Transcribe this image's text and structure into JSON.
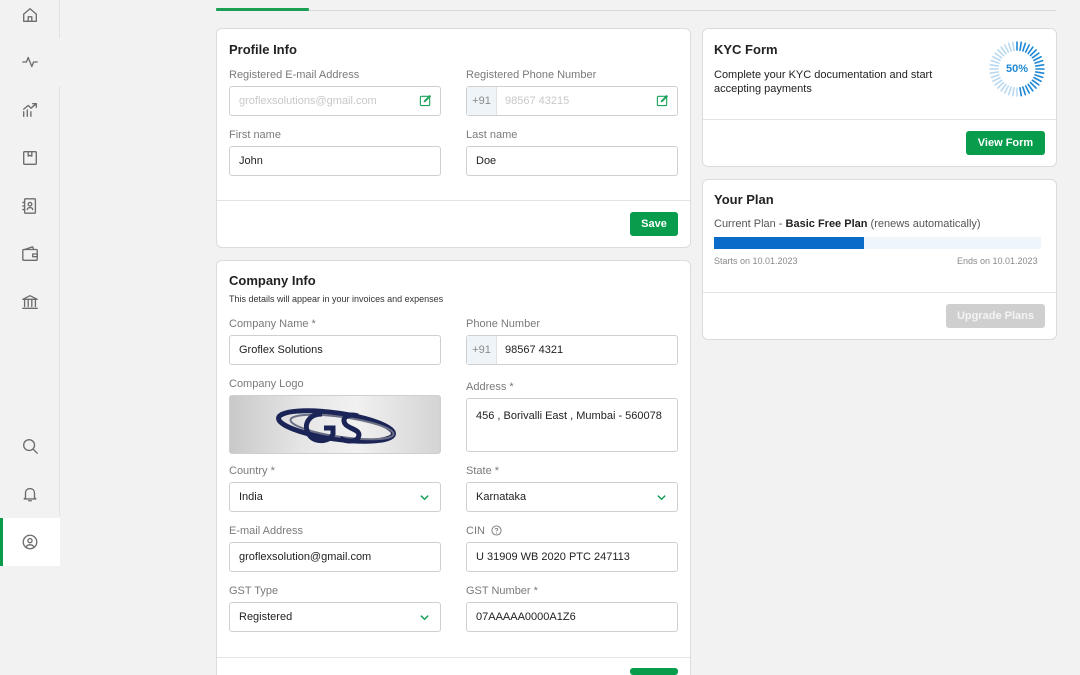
{
  "profile": {
    "title": "Profile Info",
    "email_label": "Registered E-mail Address",
    "email_value": "groflexsolutions@gmail.com",
    "phone_label": "Registered Phone Number",
    "phone_prefix": "+91",
    "phone_value": "98567 43215",
    "first_name_label": "First name",
    "first_name_value": "John",
    "last_name_label": "Last name",
    "last_name_value": "Doe",
    "save_label": "Save"
  },
  "company": {
    "title": "Company Info",
    "subtitle": "This details will appear in your invoices and expenses",
    "name_label": "Company Name *",
    "name_value": "Groflex Solutions",
    "phone_label": "Phone Number",
    "phone_prefix": "+91",
    "phone_value": "98567 4321",
    "logo_label": "Company Logo",
    "address_label": "Address *",
    "address_value": "456 , Borivalli East , Mumbai - 560078",
    "country_label": "Country *",
    "country_value": "India",
    "state_label": "State *",
    "state_value": "Karnataka",
    "email_label": "E-mail Address",
    "email_value": "groflexsolution@gmail.com",
    "cin_label": "CIN",
    "cin_value": "U 31909 WB 2020 PTC 247113",
    "gst_type_label": "GST Type",
    "gst_type_value": "Registered",
    "gst_number_label": "GST Number *",
    "gst_number_value": "07AAAAA0000A1Z6"
  },
  "kyc": {
    "title": "KYC Form",
    "description": "Complete your KYC documentation and start accepting payments",
    "percent_label": "50%",
    "progress": 0.5,
    "button_label": "View Form"
  },
  "plan": {
    "title": "Your Plan",
    "current_prefix": "Current Plan - ",
    "plan_name": "Basic Free Plan",
    "renew_note": " (renews automatically)",
    "progress": 0.46,
    "start_text": "Starts on 10.01.2023",
    "end_text": "Ends on 10.01.2023",
    "upgrade_label": "Upgrade Plans"
  },
  "colors": {
    "accent_green": "#079d4c",
    "progress_blue": "#0a6cc8"
  }
}
